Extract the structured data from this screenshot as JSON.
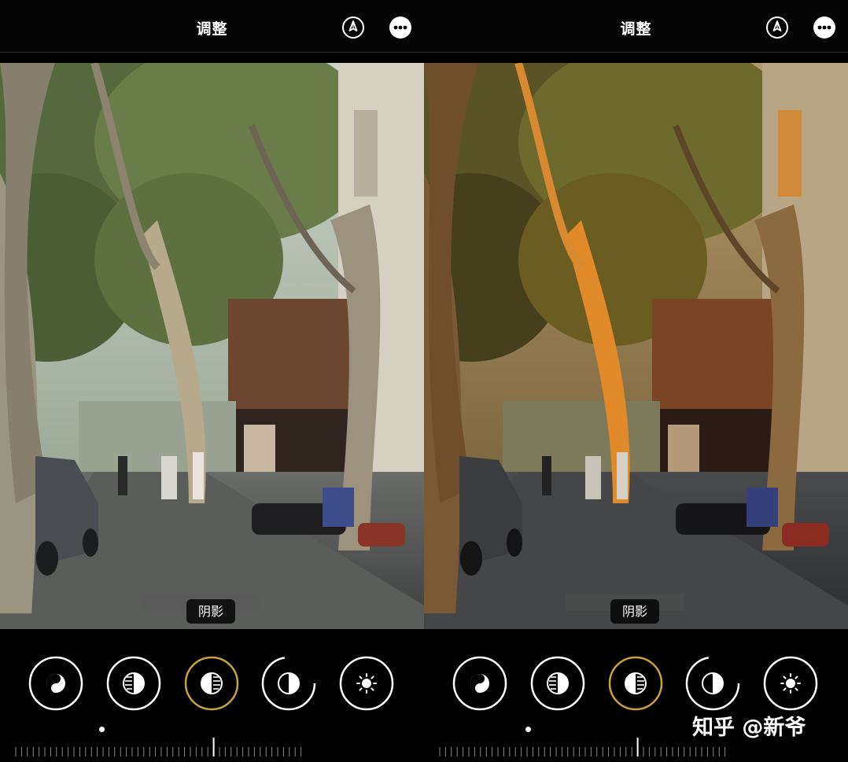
{
  "panels": [
    {
      "id": "left",
      "title": "调整",
      "adjustment_tag": "阴影",
      "tools": [
        {
          "icon": "auto-enhance-icon",
          "state": "normal"
        },
        {
          "icon": "exposure-icon",
          "state": "normal"
        },
        {
          "icon": "shadows-icon",
          "state": "selected"
        },
        {
          "icon": "contrast-icon",
          "state": "normal"
        },
        {
          "icon": "brightness-icon",
          "state": "normal"
        }
      ]
    },
    {
      "id": "right",
      "title": "调整",
      "adjustment_tag": "阴影",
      "tools": [
        {
          "icon": "auto-enhance-icon",
          "state": "normal"
        },
        {
          "icon": "exposure-icon",
          "state": "normal"
        },
        {
          "icon": "shadows-icon",
          "state": "selected"
        },
        {
          "icon": "contrast-icon",
          "state": "normal"
        },
        {
          "icon": "brightness-icon",
          "state": "normal"
        }
      ]
    }
  ],
  "top_icons": [
    "markup-pen-icon",
    "more-options-icon"
  ],
  "watermark": "知乎 @新爷",
  "colors": {
    "selected_ring": "#c9a23a",
    "ring": "#ffffff",
    "background": "#000000"
  }
}
